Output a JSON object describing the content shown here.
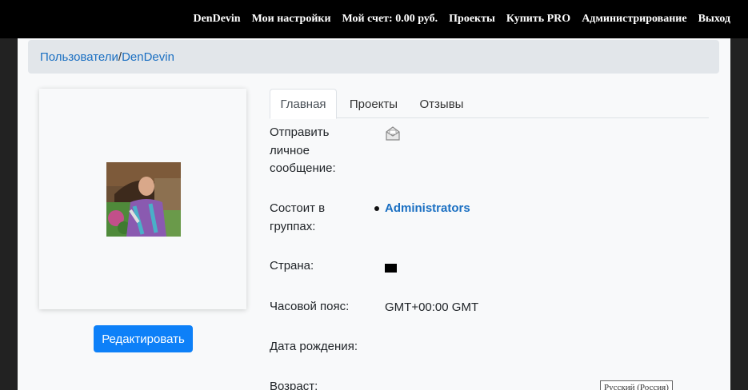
{
  "topnav": {
    "items": [
      {
        "label": "DenDevin"
      },
      {
        "label": "Мои настройки"
      },
      {
        "label": "Мой счет: 0.00 руб."
      },
      {
        "label": "Проекты"
      },
      {
        "label": "Купить PRO"
      },
      {
        "label": "Администрирование"
      },
      {
        "label": "Выход"
      }
    ]
  },
  "breadcrumb": {
    "users": "Пользователи",
    "separator": "/",
    "current": "DenDevin"
  },
  "profile": {
    "edit_label": "Редактировать"
  },
  "tabs": [
    {
      "label": "Главная",
      "active": true
    },
    {
      "label": "Проекты",
      "active": false
    },
    {
      "label": "Отзывы",
      "active": false
    }
  ],
  "fields": {
    "send_message": {
      "label_lines": [
        "Отправить",
        "личное",
        "сообщение:"
      ],
      "icon": "envelope-icon"
    },
    "groups": {
      "label_lines": [
        "Состоит в",
        "группах:"
      ],
      "items": [
        "Administrators"
      ]
    },
    "country": {
      "label": "Страна:",
      "icon": "flag-icon"
    },
    "timezone": {
      "label": "Часовой пояс:",
      "value": "GMT+00:00 GMT"
    },
    "birthday": {
      "label": "Дата рождения:",
      "value": ""
    },
    "age": {
      "label": "Возраст:",
      "value": ""
    }
  },
  "language_badge": "Русский (Россия)",
  "colors": {
    "topbar": "#000000",
    "link": "#1a6fc2",
    "button": "#0d80f8",
    "breadcrumb_bg": "#e2e6ea",
    "content_bg": "#f8f9fa"
  }
}
